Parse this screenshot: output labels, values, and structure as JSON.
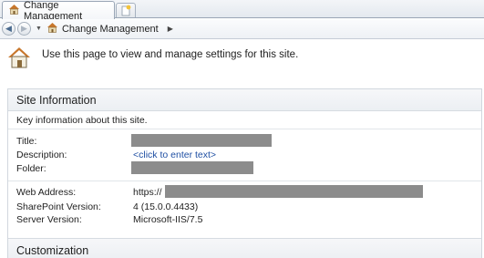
{
  "tab": {
    "title": "Change Management"
  },
  "breadcrumb": {
    "site": "Change Management"
  },
  "intro": {
    "text": "Use this page to view and manage settings for this site."
  },
  "site_info": {
    "heading": "Site Information",
    "description": "Key information about this site.",
    "fields": {
      "title_label": "Title:",
      "description_label": "Description:",
      "description_value": "<click to enter text>",
      "folder_label": "Folder:",
      "web_address_label": "Web Address:",
      "web_address_prefix": "https://",
      "sharepoint_version_label": "SharePoint Version:",
      "sharepoint_version_value": "4 (15.0.0.4433)",
      "server_version_label": "Server Version:",
      "server_version_value": "Microsoft-IIS/7.5"
    }
  },
  "customization": {
    "heading": "Customization"
  },
  "colors": {
    "link": "#1f4fa3",
    "redaction": "#8c8c8c"
  },
  "icons": {
    "tab": "home-icon",
    "new_tab": "new-tab-icon",
    "back": "back-arrow-icon",
    "forward": "forward-arrow-icon",
    "intro": "home-large-icon"
  }
}
